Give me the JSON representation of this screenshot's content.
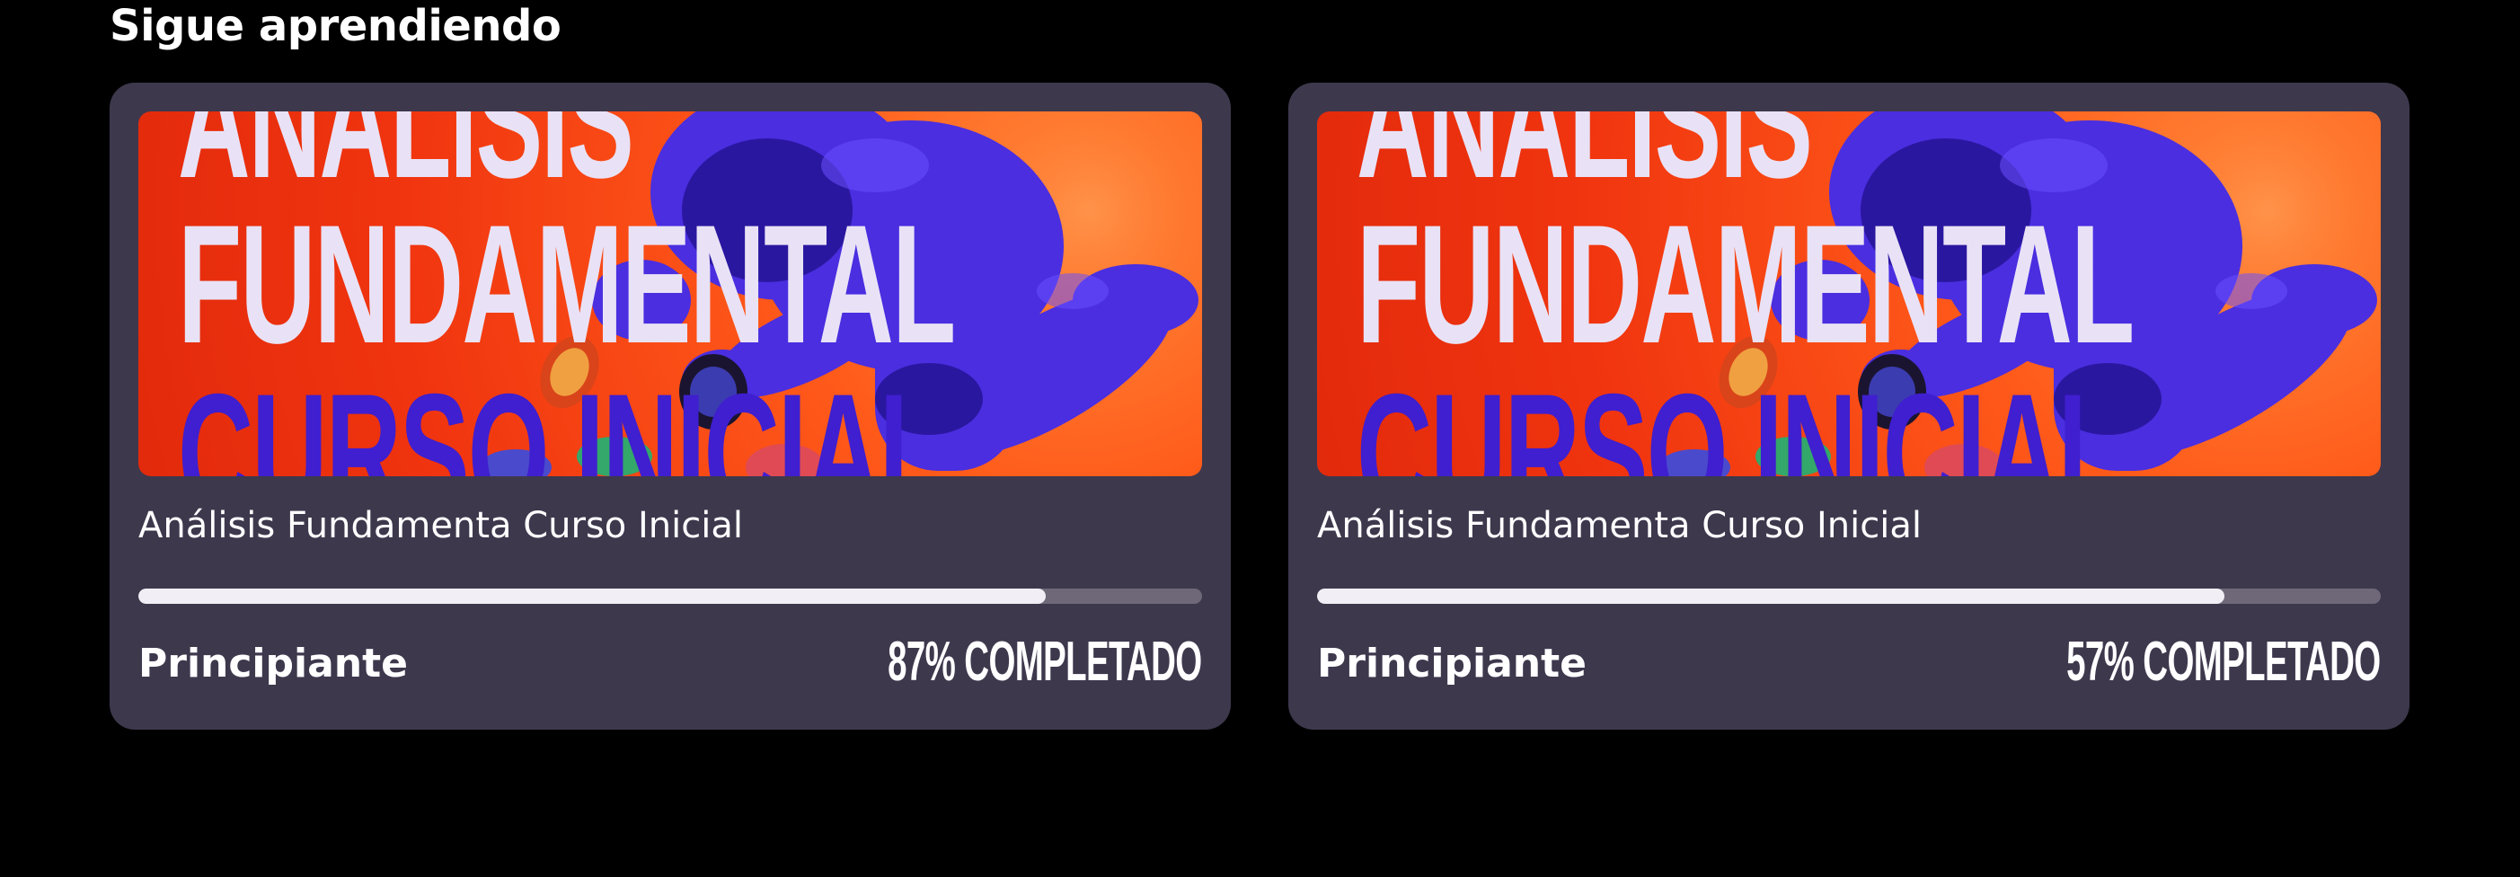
{
  "section": {
    "title": "Sigue aprendiendo"
  },
  "courses": [
    {
      "thumbnail": {
        "line1": "ANALISIS",
        "line2": "FUNDAMENTAL",
        "line3": "CURSO INICIAL"
      },
      "title": "Análisis Fundamenta Curso Inicial",
      "progress": 0.853,
      "level": "Principiante",
      "percent_text": "87% COMPLETADO"
    },
    {
      "thumbnail": {
        "line1": "ANALISIS",
        "line2": "FUNDAMENTAL",
        "line3": "CURSO INICIAL"
      },
      "title": "Análisis Fundamenta Curso Inicial",
      "progress": 0.853,
      "level": "Principiante",
      "percent_text": "57% COMPLETADO"
    }
  ],
  "colors": {
    "background": "#000000",
    "card": "#3e384d",
    "track": "#6e6878",
    "fill": "#f1eff5",
    "thumb_orange": "#f0340f",
    "astronaut": "#4a2ee0"
  },
  "icons": [
    "astronaut-illustration",
    "crypto-coin-icon"
  ]
}
